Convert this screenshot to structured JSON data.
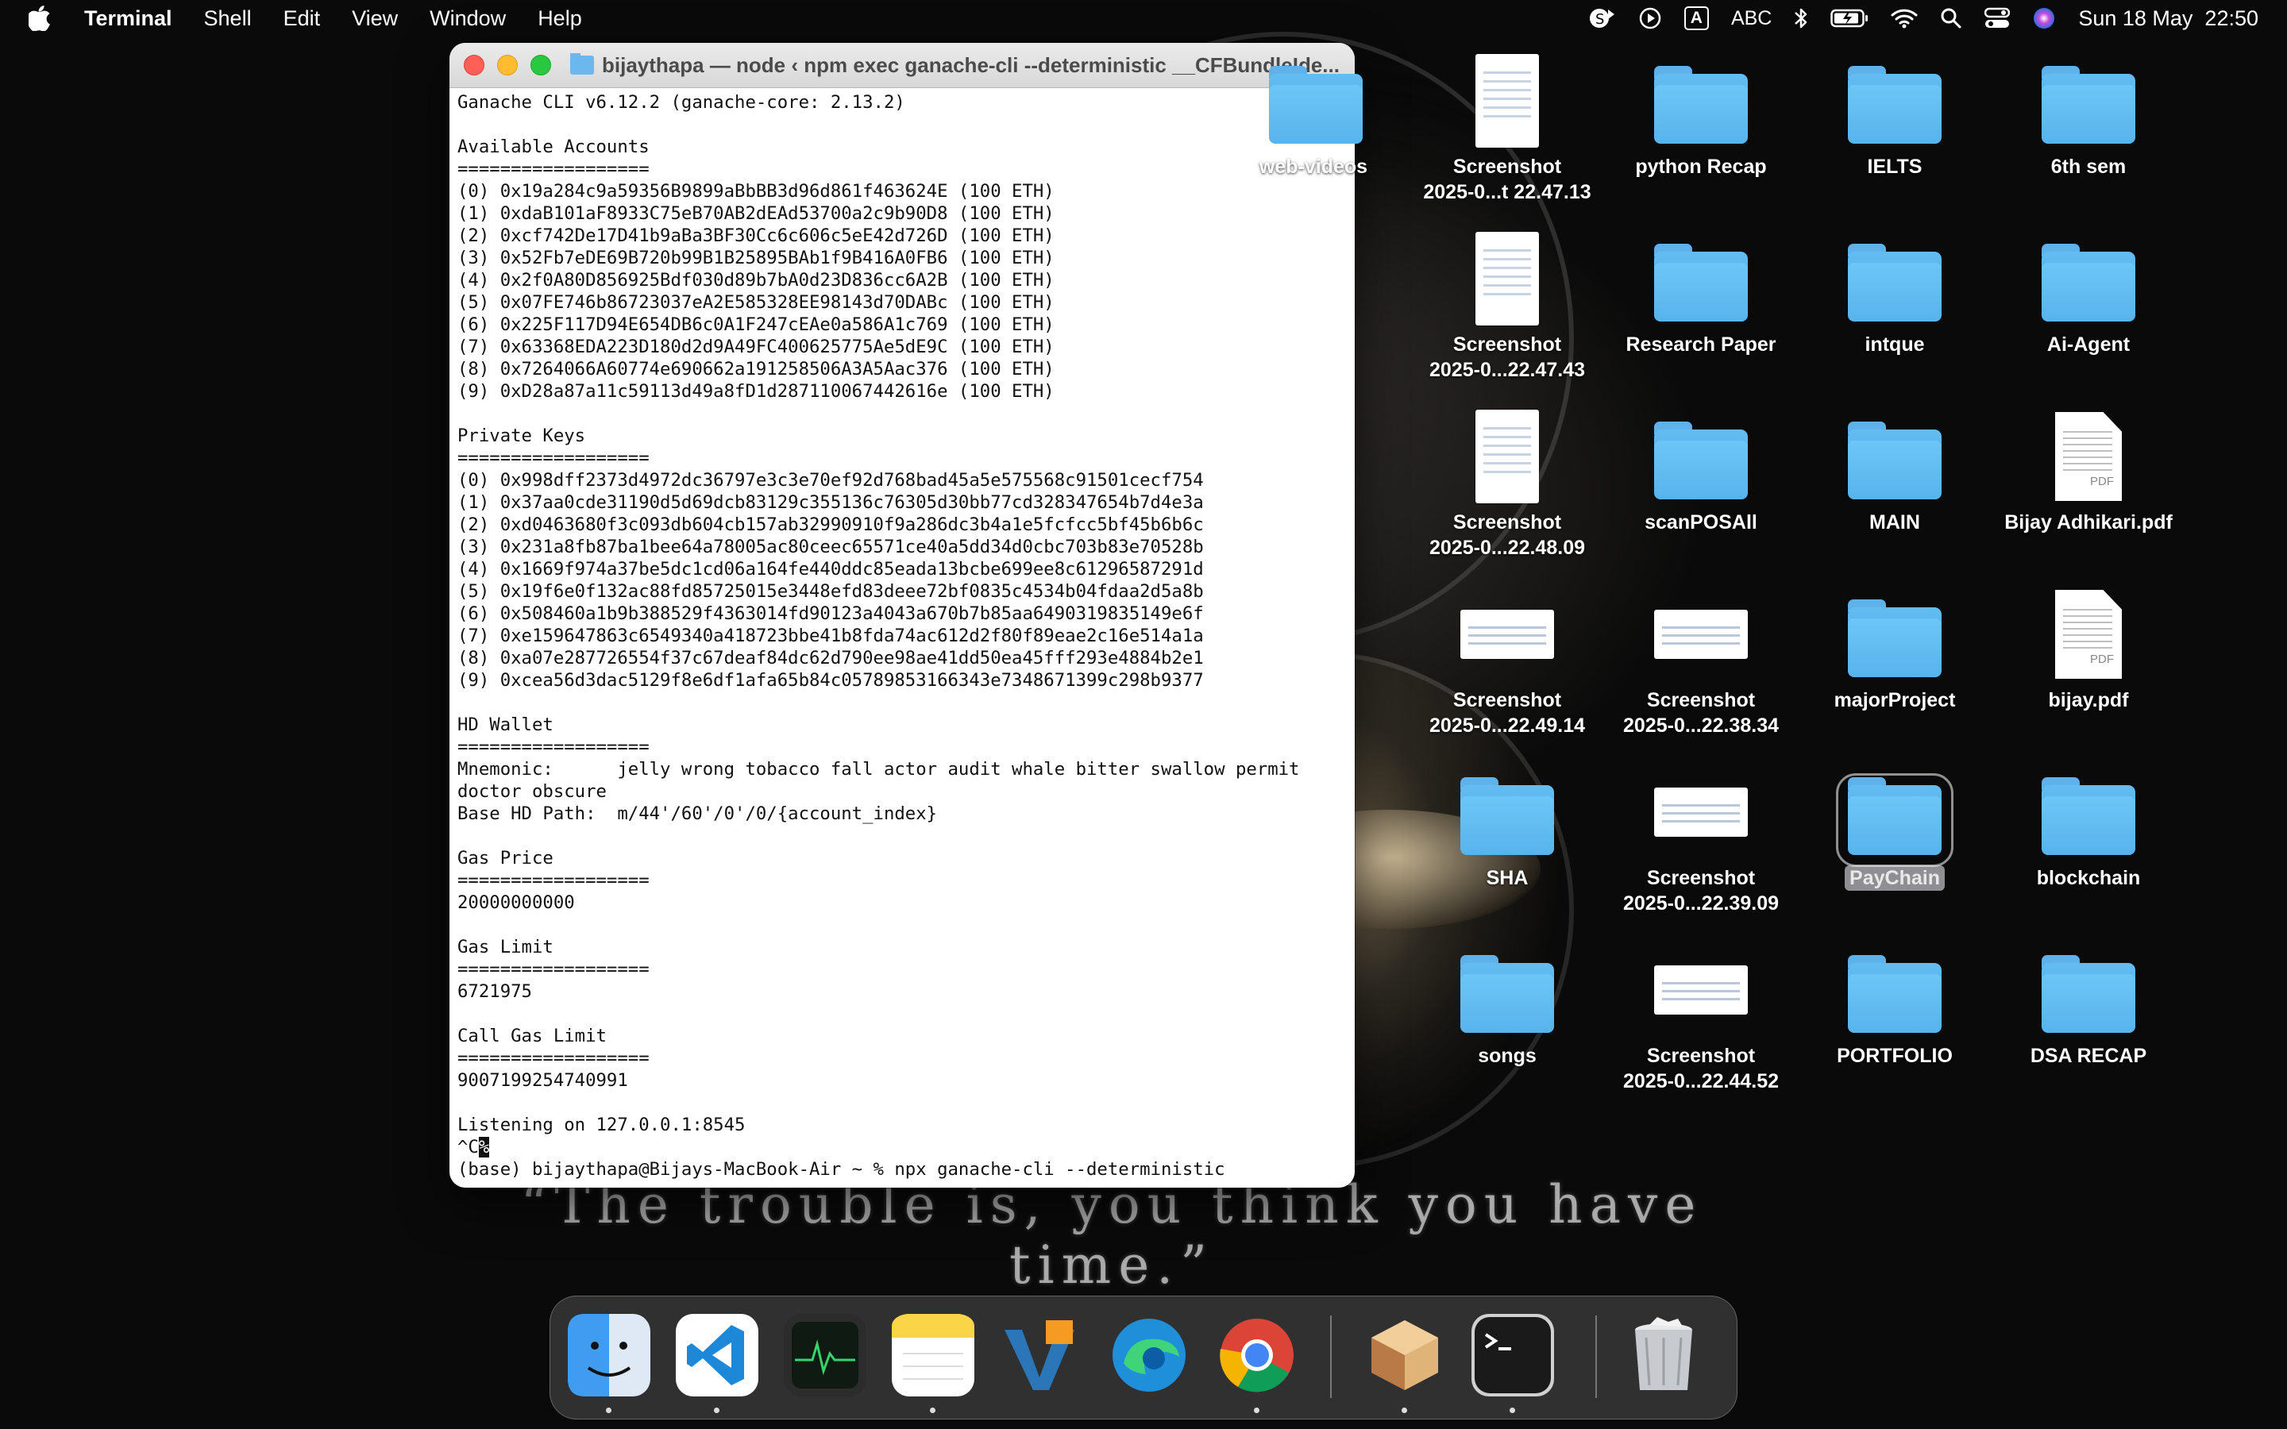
{
  "menubar": {
    "app": "Terminal",
    "items": [
      "Shell",
      "Edit",
      "View",
      "Window",
      "Help"
    ],
    "input_badge": "A",
    "input_source": "ABC",
    "datetime": "Sun 18 May  22:50"
  },
  "terminal": {
    "title": "bijaythapa — node ‹ npm exec ganache-cli --deterministic __CFBundleIde...",
    "lines": [
      "Ganache CLI v6.12.2 (ganache-core: 2.13.2)",
      "",
      "Available Accounts",
      "==================",
      "(0) 0x19a284c9a59356B9899aBbBB3d96d861f463624E (100 ETH)",
      "(1) 0xdaB101aF8933C75eB70AB2dEAd53700a2c9b90D8 (100 ETH)",
      "(2) 0xcf742De17D41b9aBa3BF30Cc6c606c5eE42d726D (100 ETH)",
      "(3) 0x52Fb7eDE69B720b99B1B25895BAb1f9B416A0FB6 (100 ETH)",
      "(4) 0x2f0A80D856925Bdf030d89b7bA0d23D836cc6A2B (100 ETH)",
      "(5) 0x07FE746b86723037eA2E585328EE98143d70DABc (100 ETH)",
      "(6) 0x225F117D94E654DB6c0A1F247cEAe0a586A1c769 (100 ETH)",
      "(7) 0x63368EDA223D180d2d9A49FC400625775Ae5dE9C (100 ETH)",
      "(8) 0x7264066A60774e690662a191258506A3A5Aac376 (100 ETH)",
      "(9) 0xD28a87a11c59113d49a8fD1d287110067442616e (100 ETH)",
      "",
      "Private Keys",
      "==================",
      "(0) 0x998dff2373d4972dc36797e3c3e70ef92d768bad45a5e575568c91501cecf754",
      "(1) 0x37aa0cde31190d5d69dcb83129c355136c76305d30bb77cd328347654b7d4e3a",
      "(2) 0xd0463680f3c093db604cb157ab32990910f9a286dc3b4a1e5fcfcc5bf45b6b6c",
      "(3) 0x231a8fb87ba1bee64a78005ac80ceec65571ce40a5dd34d0cbc703b83e70528b",
      "(4) 0x1669f974a37be5dc1cd06a164fe440ddc85eada13bcbe699ee8c61296587291d",
      "(5) 0x19f6e0f132ac88fd85725015e3448efd83deee72bf0835c4534b04fdaa2d5a8b",
      "(6) 0x508460a1b9b388529f4363014fd90123a4043a670b7b85aa6490319835149e6f",
      "(7) 0xe159647863c6549340a418723bbe41b8fda74ac612d2f80f89eae2c16e514a1a",
      "(8) 0xa07e287726554f37c67deaf84dc62d790ee98ae41dd50ea45fff293e4884b2e1",
      "(9) 0xcea56d3dac5129f8e6df1afa65b84c05789853166343e7348671399c298b9377",
      "",
      "HD Wallet",
      "==================",
      "Mnemonic:      jelly wrong tobacco fall actor audit whale bitter swallow permit",
      "doctor obscure",
      "Base HD Path:  m/44'/60'/0'/0/{account_index}",
      "",
      "Gas Price",
      "==================",
      "20000000000",
      "",
      "Gas Limit",
      "==================",
      "6721975",
      "",
      "Call Gas Limit",
      "==================",
      "9007199254740991",
      "",
      "Listening on 127.0.0.1:8545",
      "^C%",
      "(base) bijaythapa@Bijays-MacBook-Air ~ % npx ganache-cli --deterministic"
    ]
  },
  "desktop": [
    {
      "name": "web-videos",
      "type": "folder"
    },
    {
      "name": "Screenshot\n2025-0...t 22.47.13",
      "type": "shot-tall"
    },
    {
      "name": "python Recap",
      "type": "folder"
    },
    {
      "name": "IELTS",
      "type": "folder"
    },
    {
      "name": "6th sem",
      "type": "folder"
    },
    {
      "name": "Screenshot\n2025-0...22.47.43",
      "type": "shot-tall"
    },
    {
      "name": "Research Paper",
      "type": "folder"
    },
    {
      "name": "intque",
      "type": "folder"
    },
    {
      "name": "Ai-Agent",
      "type": "folder"
    },
    {
      "name": "Screenshot\n2025-0...22.48.09",
      "type": "shot-tall"
    },
    {
      "name": "scanPOSAll",
      "type": "folder"
    },
    {
      "name": "MAIN",
      "type": "folder"
    },
    {
      "name": "Bijay Adhikari.pdf",
      "type": "doc"
    },
    {
      "name": "Screenshot\n2025-0...22.49.14",
      "type": "shot-wide"
    },
    {
      "name": "Screenshot\n2025-0...22.38.34",
      "type": "shot-wide"
    },
    {
      "name": "majorProject",
      "type": "folder"
    },
    {
      "name": "bijay.pdf",
      "type": "doc"
    },
    {
      "name": "SHA",
      "type": "folder"
    },
    {
      "name": "Screenshot\n2025-0...22.39.09",
      "type": "shot-wide"
    },
    {
      "name": "PayChain",
      "type": "folder",
      "selected": true
    },
    {
      "name": "blockchain",
      "type": "folder"
    },
    {
      "name": "songs",
      "type": "folder"
    },
    {
      "name": "Screenshot\n2025-0...22.44.52",
      "type": "shot-wide"
    },
    {
      "name": "PORTFOLIO",
      "type": "folder"
    },
    {
      "name": "DSA RECAP",
      "type": "folder"
    }
  ],
  "doc_badge": "PDF",
  "wallpaper_quote": {
    "line1": "“The trouble is, you think you have",
    "line2": "time.”"
  },
  "dock": [
    {
      "name": "finder-icon",
      "color": "#3f9cf0",
      "running": true
    },
    {
      "name": "vscode-icon",
      "color": "#ffffff",
      "running": true
    },
    {
      "name": "activity-monitor-icon",
      "color": "#1b1b1b",
      "running": false
    },
    {
      "name": "notes-icon",
      "color": "#fbd548",
      "running": true
    },
    {
      "name": "visual-paradigm-icon",
      "color": "#2a5f8c",
      "running": false
    },
    {
      "name": "edge-icon",
      "color": "#1e8fd8",
      "running": false
    },
    {
      "name": "chrome-icon",
      "color": "#ffffff",
      "running": true
    },
    {
      "name": "sublime-box-icon",
      "color": "#d9a86b",
      "running": true
    },
    {
      "name": "terminal-icon",
      "color": "#1a1a1a",
      "running": true
    },
    {
      "name": "trash-icon",
      "color": "#cfd3d6",
      "running": false
    }
  ]
}
